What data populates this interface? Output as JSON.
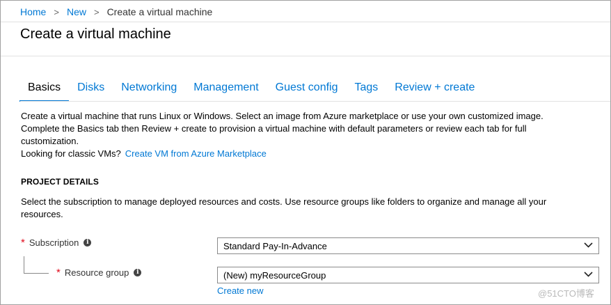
{
  "breadcrumb": {
    "home": "Home",
    "new": "New",
    "current": "Create a virtual machine",
    "separator": ">"
  },
  "page": {
    "title": "Create a virtual machine"
  },
  "tabs": [
    {
      "label": "Basics",
      "active": true
    },
    {
      "label": "Disks",
      "active": false
    },
    {
      "label": "Networking",
      "active": false
    },
    {
      "label": "Management",
      "active": false
    },
    {
      "label": "Guest config",
      "active": false
    },
    {
      "label": "Tags",
      "active": false
    },
    {
      "label": "Review + create",
      "active": false
    }
  ],
  "intro": {
    "text": "Create a virtual machine that runs Linux or Windows. Select an image from Azure marketplace or use your own customized image. Complete the Basics tab then Review + create to provision a virtual machine with default parameters or review each tab for full customization.",
    "classic_prompt": "Looking for classic VMs?",
    "classic_link": "Create VM from Azure Marketplace"
  },
  "project_details": {
    "heading": "PROJECT DETAILS",
    "description": "Select the subscription to manage deployed resources and costs. Use resource groups like folders to organize and manage all your resources.",
    "subscription": {
      "label": "Subscription",
      "value": "Standard Pay-In-Advance",
      "required_mark": "*"
    },
    "resource_group": {
      "label": "Resource group",
      "value": "(New) myResourceGroup",
      "required_mark": "*",
      "create_new": "Create new"
    }
  },
  "icons": {
    "info": "info-icon",
    "chevron": "chevron-down-icon",
    "breadcrumb_sep": "chevron-right-icon"
  },
  "colors": {
    "link": "#0078d4",
    "required": "#e00b1c",
    "active_tab_underline": "#0078d4"
  },
  "watermark": "@51CTO博客"
}
